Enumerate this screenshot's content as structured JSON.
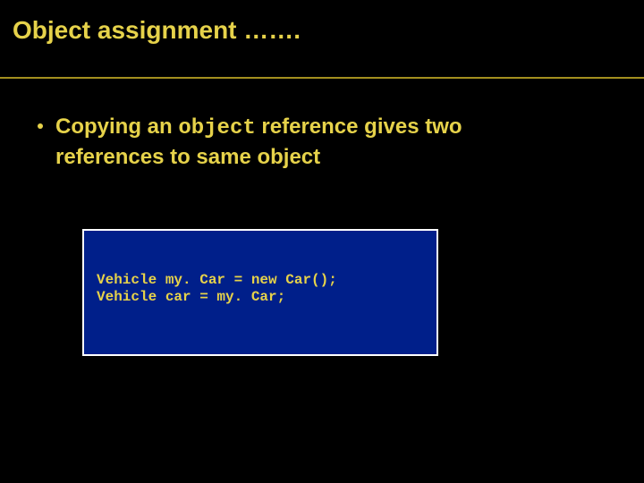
{
  "title": "Object assignment …….",
  "bullet": {
    "part1": "Copying an ",
    "code_word": "object",
    "part2": " reference gives two",
    "line2": "references to same object"
  },
  "code": {
    "line1": "Vehicle my. Car = new Car();",
    "line2": "Vehicle car = my. Car;"
  }
}
